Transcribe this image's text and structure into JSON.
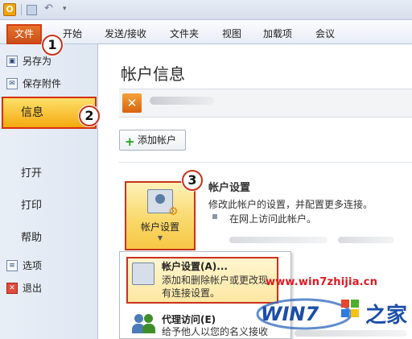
{
  "titlebar": {
    "app_icon_label": "O",
    "undo_glyph": "↶",
    "dropdown_glyph": "▾"
  },
  "ribbon": {
    "tabs": [
      "文件",
      "开始",
      "发送/接收",
      "文件夹",
      "视图",
      "加载项",
      "会议"
    ]
  },
  "sidebar": {
    "items": [
      {
        "label": "另存为",
        "icon": "save-as-icon"
      },
      {
        "label": "保存附件",
        "icon": "attachment-icon"
      },
      {
        "label": "信息",
        "active": true
      },
      {
        "label": "打开"
      },
      {
        "label": "打印"
      },
      {
        "label": "帮助"
      },
      {
        "label": "选项",
        "icon": "options-icon"
      },
      {
        "label": "退出",
        "icon": "exit-icon"
      }
    ]
  },
  "main": {
    "heading": "帐户信息",
    "add_account_label": "添加帐户",
    "account_settings": {
      "button_label": "帐户设置",
      "title": "帐户设置",
      "description": "修改此帐户的设置，并配置更多连接。",
      "link": "在网上访问此帐户。"
    },
    "dropdown": {
      "items": [
        {
          "title": "帐户设置(A)...",
          "desc_line1": "添加和删除帐户或更改现",
          "desc_line2": "有连接设置。"
        },
        {
          "title": "代理访问(E)",
          "desc_line1": "给予他人以您的名义接收"
        }
      ]
    }
  },
  "annotations": {
    "step1": "1",
    "step2": "2",
    "step3": "3"
  },
  "watermark": {
    "url": "www.win7zhijia.cn",
    "logo_text": "WIN7",
    "logo_suffix": "之家"
  },
  "colors": {
    "highlight_border": "#c8321a",
    "file_tab": "#d9601f",
    "active_item": "#f7c233",
    "watermark": "#e0171f"
  }
}
